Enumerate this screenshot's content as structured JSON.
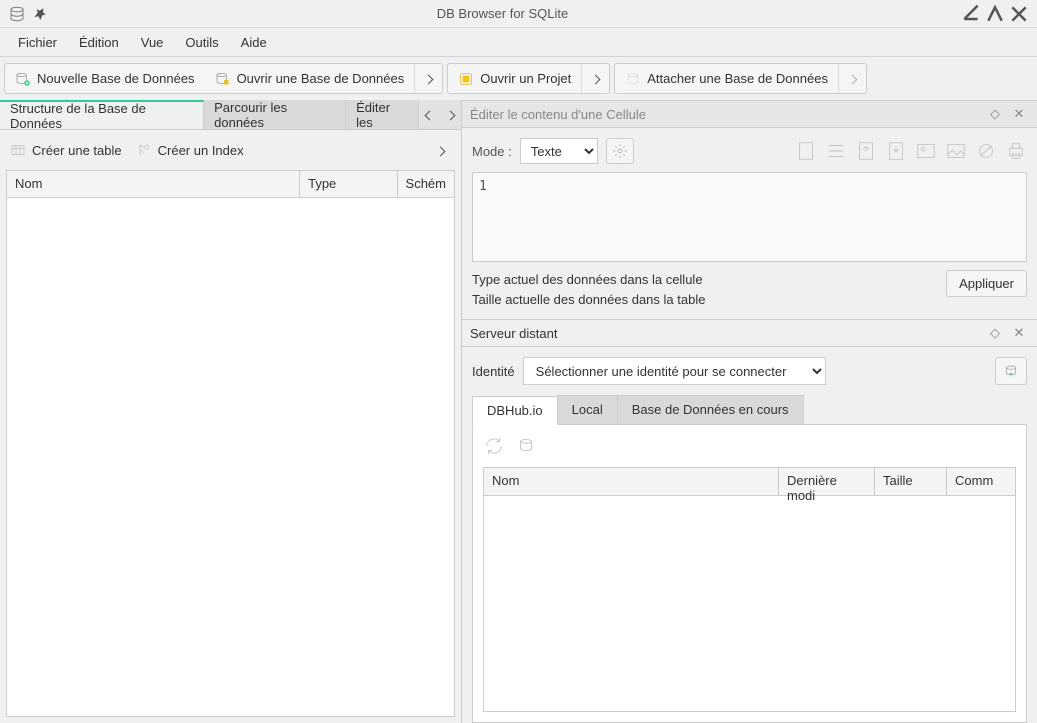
{
  "window": {
    "title": "DB Browser for SQLite"
  },
  "menu": {
    "file": "Fichier",
    "edit": "Édition",
    "view": "Vue",
    "tools": "Outils",
    "help": "Aide"
  },
  "toolbar": {
    "new_db": "Nouvelle Base de Données",
    "open_db": "Ouvrir une Base de Données",
    "open_project": "Ouvrir un Projet",
    "attach_db": "Attacher une Base de Données"
  },
  "left": {
    "tabs": {
      "structure": "Structure de la Base de Données",
      "browse": "Parcourir les données",
      "edit": "Éditer les"
    },
    "sub": {
      "create_table": "Créer une table",
      "create_index": "Créer un Index"
    },
    "cols": {
      "name": "Nom",
      "type": "Type",
      "schema": "Schém"
    }
  },
  "cell": {
    "title": "Éditer le contenu d'une Cellule",
    "mode_label": "Mode :",
    "mode_value": "Texte",
    "content": "1",
    "info1": "Type actuel des données dans la cellule",
    "info2": "Taille actuelle des données dans la table",
    "apply": "Appliquer"
  },
  "remote": {
    "title": "Serveur distant",
    "identity_label": "Identité",
    "identity_value": "Sélectionner une identité pour se connecter",
    "tabs": {
      "dbhub": "DBHub.io",
      "local": "Local",
      "current": "Base de Données en cours"
    },
    "cols": {
      "name": "Nom",
      "modified": "Dernière modi",
      "size": "Taille",
      "comm": "Comm"
    }
  }
}
